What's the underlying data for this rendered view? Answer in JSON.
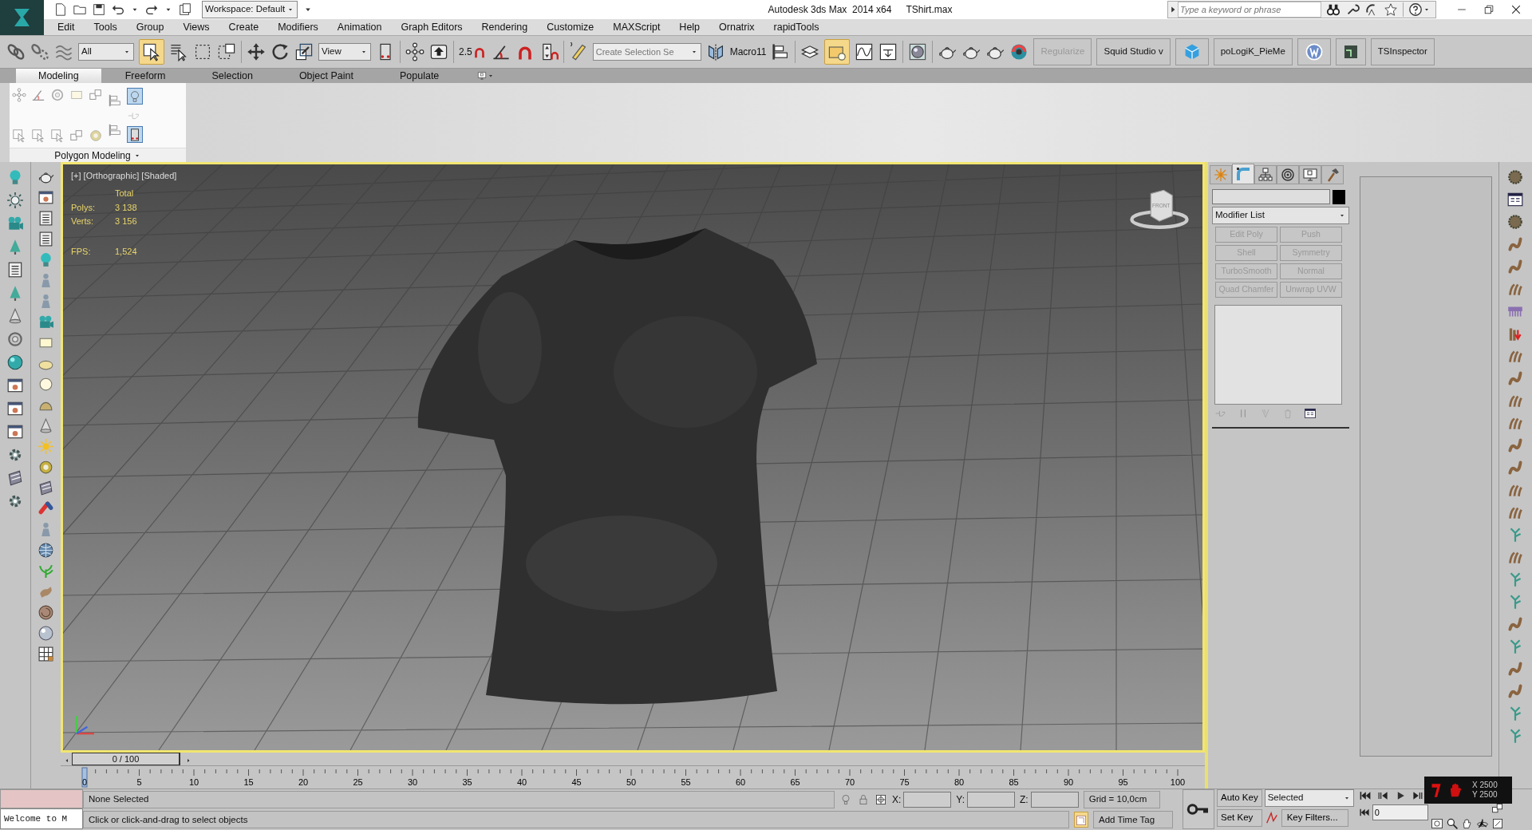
{
  "title_bar": {
    "workspace": "Workspace: Default",
    "app": "Autodesk 3ds Max  2014 x64",
    "file": "TShirt.max",
    "search": {
      "placeholder": "Type a keyword or phrase"
    }
  },
  "menu": [
    "Edit",
    "Tools",
    "Group",
    "Views",
    "Create",
    "Modifiers",
    "Animation",
    "Graph Editors",
    "Rendering",
    "Customize",
    "MAXScript",
    "Help",
    "Ornatrix",
    "rapidTools"
  ],
  "main_toolbar": {
    "selection_filter": "All",
    "reference_coord": "View",
    "snap_label": "2.5",
    "named_selection": {
      "placeholder": "Create Selection Se"
    },
    "macro": "Macro11",
    "buttons": [
      {
        "label": "Regularize",
        "disabled": true
      },
      {
        "label": "Squid Studio v",
        "disabled": false
      },
      {
        "label": "poLogiK_PieMe",
        "disabled": false
      },
      {
        "label": "TSInspector",
        "disabled": false
      }
    ]
  },
  "ribbon": {
    "tabs": [
      {
        "label": "Modeling",
        "selected": true
      },
      {
        "label": "Freeform",
        "selected": false
      },
      {
        "label": "Selection",
        "selected": false
      },
      {
        "label": "Object Paint",
        "selected": false
      },
      {
        "label": "Populate",
        "selected": false
      }
    ],
    "panel": "Polygon Modeling"
  },
  "viewport": {
    "label": "[+] [Orthographic] [Shaded]",
    "stats_header": "Total",
    "stats": [
      {
        "label": "Polys:",
        "value": "3 138"
      },
      {
        "label": "Verts:",
        "value": "3 156"
      },
      {
        "label": "FPS:",
        "value": "1,524"
      }
    ],
    "viewcube": "FRONT"
  },
  "time_slider": {
    "label": "0 / 100",
    "level": 0
  },
  "track_labels": [
    "0",
    "5",
    "10",
    "15",
    "20",
    "25",
    "30",
    "35",
    "40",
    "45",
    "50",
    "55",
    "60",
    "65",
    "70",
    "75",
    "80",
    "85",
    "90",
    "95",
    "100"
  ],
  "command_panel": {
    "tabs": [
      {
        "selected": false
      },
      {
        "selected": true
      },
      {
        "selected": false
      },
      {
        "selected": false
      },
      {
        "selected": false
      },
      {
        "selected": false
      }
    ],
    "modifier_list": "Modifier List",
    "modifier_buttons": [
      {
        "label": "Edit Poly",
        "disabled": true
      },
      {
        "label": "Push",
        "disabled": true
      },
      {
        "label": "Shell",
        "disabled": true
      },
      {
        "label": "Symmetry",
        "disabled": true
      },
      {
        "label": "TurboSmooth",
        "disabled": true
      },
      {
        "label": "Normal",
        "disabled": true
      },
      {
        "label": "Quad Chamfer",
        "disabled": true
      },
      {
        "label": "Unwrap UVW",
        "disabled": true
      }
    ]
  },
  "status": {
    "maxscript": "Welcome to M",
    "selection": "None Selected",
    "prompt": "Click or click-and-drag to select objects",
    "coords": [
      {
        "label": "X:"
      },
      {
        "label": "Y:"
      },
      {
        "label": "Z:"
      }
    ],
    "grid": "Grid = 10,0cm",
    "add_time_tag": "Add Time Tag"
  },
  "animation": {
    "auto_key": "Auto Key",
    "set_key": "Set Key",
    "key_mode": "Selected",
    "key_filters": "Key Filters...",
    "frame": "0"
  },
  "overlay": {
    "x": "X 2500",
    "y": "Y 2500"
  }
}
